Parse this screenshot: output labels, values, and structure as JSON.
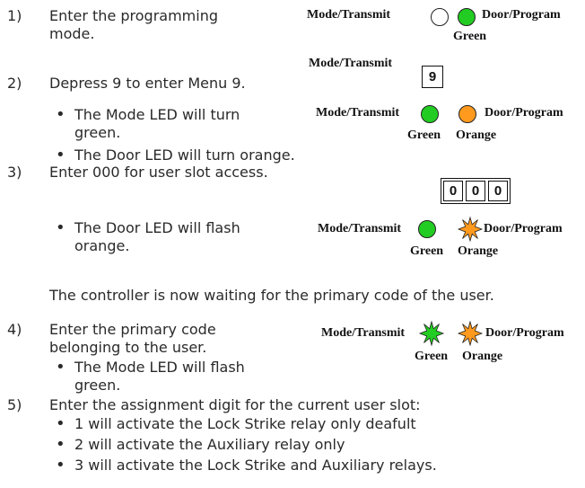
{
  "steps": {
    "s1": {
      "num": "1)",
      "l1": "Enter the programming",
      "l2": "mode."
    },
    "s2": {
      "num": "2)",
      "text": "Depress 9 to enter Menu 9.",
      "b1a": "The Mode LED will turn",
      "b1b": "green.",
      "b2": "The Door LED will turn orange."
    },
    "s3": {
      "num": "3)",
      "text": "Enter 000 for user slot access.",
      "b1a": "The Door LED will flash",
      "b1b": "orange."
    },
    "note": "The controller is now waiting for the primary code of the user.",
    "s4": {
      "num": "4)",
      "l1": "Enter the primary code",
      "l2": "belonging to the user.",
      "b1a": "The Mode LED will flash",
      "b1b": "green."
    },
    "s5": {
      "num": "5)",
      "text": "Enter the assignment digit for the current user slot:",
      "b1": "1 will activate the Lock Strike relay only deafult",
      "b2": "2 will activate the Auxiliary relay only",
      "b3": "3 will activate the Lock Strike and Auxiliary relays."
    }
  },
  "diagram": {
    "mode_label": "Mode/Transmit",
    "door_label": "Door/Program",
    "green": "Green",
    "orange": "Orange",
    "key_9": "9",
    "keys_000": [
      "0",
      "0",
      "0"
    ]
  },
  "colors": {
    "green": "#22cc22",
    "orange": "#ff9a1e",
    "outline": "#222222"
  }
}
